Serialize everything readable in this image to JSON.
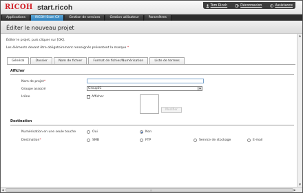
{
  "header": {
    "logo": "RICOH",
    "site_name": "start.ricoh",
    "user_link": "Tom Ricoh",
    "logout_link": "Déconnexion",
    "help_link": "Assistance"
  },
  "menu": [
    {
      "label": "Applications",
      "active": false
    },
    {
      "label": "RICOH Scan CX",
      "active": true
    },
    {
      "label": "Gestion de services",
      "active": false
    },
    {
      "label": "Gestion utilisateur",
      "active": false
    },
    {
      "label": "Paramètres",
      "active": false
    }
  ],
  "page": {
    "title": "Éditer le nouveau projet",
    "instruction_1": "Éditer le projet, puis cliquer sur [OK].",
    "instruction_2": "Les éléments devant être obligatoirement renseignés présentent la marque",
    "required_mark": "*"
  },
  "tabs": [
    {
      "label": "Général",
      "active": true
    },
    {
      "label": "Dossier",
      "active": false
    },
    {
      "label": "Nom de fichier",
      "active": false
    },
    {
      "label": "Format de fichier/Numérisation",
      "active": false
    },
    {
      "label": "Liste de termes",
      "active": false
    }
  ],
  "afficher": {
    "section_title": "Afficher",
    "project_name_label": "Nom de projet",
    "project_name_value": "",
    "group_label": "Groupe associé",
    "group_value": "Group01",
    "icon_label": "Icône",
    "icon_checkbox_label": "Afficher",
    "icon_checked": false,
    "modify_button": "Modifier"
  },
  "destination": {
    "section_title": "Destination",
    "one_touch_label": "Numérisation en une seule touche",
    "one_touch_options": [
      {
        "label": "Oui",
        "selected": false
      },
      {
        "label": "Non",
        "selected": true
      }
    ],
    "destination_label": "Destination",
    "destination_options": [
      {
        "label": "SMB",
        "selected": false
      },
      {
        "label": "FTP",
        "selected": false
      },
      {
        "label": "Service de stockage",
        "selected": false
      },
      {
        "label": "E-mail",
        "selected": false
      }
    ]
  },
  "colors": {
    "brand_red": "#d2232a",
    "active_tab_blue": "#2f7fb9",
    "menubar": "#2c2c2c"
  }
}
